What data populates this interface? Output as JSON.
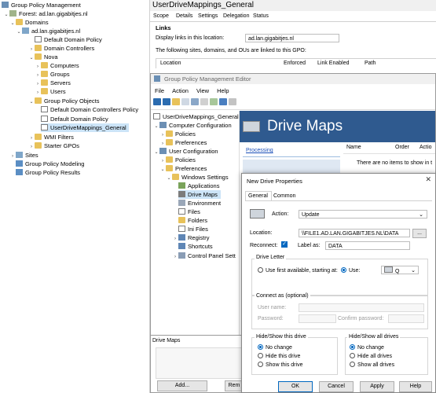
{
  "gpm_tree": [
    {
      "label": "Group Policy Management",
      "icon": "gpm-icon"
    },
    {
      "label": "Forest: ad.lan.gigabitjes.nl",
      "icon": "forest-icon"
    },
    {
      "label": "Domains",
      "icon": "folder-icon"
    },
    {
      "label": "ad.lan.gigabitjes.nl",
      "icon": "domain-icon"
    },
    {
      "label": "Default Domain Policy",
      "icon": "gpo-link-icon"
    },
    {
      "label": "Domain Controllers",
      "icon": "ou-icon"
    },
    {
      "label": "Nova",
      "icon": "ou-icon"
    },
    {
      "label": "Computers",
      "icon": "ou-icon"
    },
    {
      "label": "Groups",
      "icon": "ou-icon"
    },
    {
      "label": "Servers",
      "icon": "ou-icon"
    },
    {
      "label": "Users",
      "icon": "ou-icon"
    },
    {
      "label": "Group Policy Objects",
      "icon": "folder-icon"
    },
    {
      "label": "Default Domain Controllers Policy",
      "icon": "gpo-icon"
    },
    {
      "label": "Default Domain Policy",
      "icon": "gpo-icon"
    },
    {
      "label": "UserDriveMappings_General",
      "icon": "gpo-icon"
    },
    {
      "label": "WMI Filters",
      "icon": "folder-icon"
    },
    {
      "label": "Starter GPOs",
      "icon": "folder-icon"
    },
    {
      "label": "Sites",
      "icon": "sites-icon"
    },
    {
      "label": "Group Policy Modeling",
      "icon": "modeling-icon"
    },
    {
      "label": "Group Policy Results",
      "icon": "results-icon"
    }
  ],
  "gpm_right": {
    "title": "UserDriveMappings_General",
    "tabs": [
      "Scope",
      "Details",
      "Settings",
      "Delegation",
      "Status"
    ],
    "links_heading": "Links",
    "display_links_label": "Display links in this location:",
    "display_links_value": "ad.lan.gigabitjes.nl",
    "linked_text": "The following sites, domains, and OUs are linked to this GPO:",
    "columns": [
      "Location",
      "Enforced",
      "Link Enabled",
      "Path"
    ]
  },
  "editor": {
    "title": "Group Policy Management Editor",
    "menu": [
      "File",
      "Action",
      "View",
      "Help"
    ],
    "tree": [
      {
        "label": "UserDriveMappings_General"
      },
      {
        "label": "Computer Configuration"
      },
      {
        "label": "Policies"
      },
      {
        "label": "Preferences"
      },
      {
        "label": "User Configuration"
      },
      {
        "label": "Policies"
      },
      {
        "label": "Preferences"
      },
      {
        "label": "Windows Settings"
      },
      {
        "label": "Applications"
      },
      {
        "label": "Drive Maps"
      },
      {
        "label": "Environment"
      },
      {
        "label": "Files"
      },
      {
        "label": "Folders"
      },
      {
        "label": "Ini Files"
      },
      {
        "label": "Registry"
      },
      {
        "label": "Shortcuts"
      },
      {
        "label": "Control Panel Sett"
      }
    ],
    "banner_title": "Drive Maps",
    "processing_link": "Processing",
    "list_columns": [
      "Name",
      "Order",
      "Actio"
    ],
    "empty_text": "There are no items to show in t",
    "bottom_tab": "Drive Maps",
    "add_button": "Add...",
    "remove_button": "Rem"
  },
  "dialog": {
    "title": "New Drive Properties",
    "tabs": [
      "General",
      "Common"
    ],
    "action_label": "Action:",
    "action_value": "Update",
    "location_label": "Location:",
    "location_value": "\\\\FILE1.AD.LAN.GIGABITJES.NL\\DATA",
    "browse_button": "...",
    "reconnect_label": "Reconnect:",
    "label_as_label": "Label as:",
    "label_as_value": "DATA",
    "drive_letter_heading": "Drive Letter",
    "use_first_label": "Use first available, starting at:",
    "use_label": "Use:",
    "drive_value": "Q",
    "connect_as_heading": "Connect as (optional)",
    "user_name_label": "User name:",
    "password_label": "Password:",
    "confirm_password_label": "Confirm password:",
    "hide_show_drive_heading": "Hide/Show this drive",
    "hide_show_drive_options": [
      "No change",
      "Hide this drive",
      "Show this drive"
    ],
    "hide_show_all_heading": "Hide/Show all drives",
    "hide_show_all_options": [
      "No change",
      "Hide all drives",
      "Show all drives"
    ],
    "ok_button": "OK",
    "cancel_button": "Cancel",
    "apply_button": "Apply",
    "help_button": "Help"
  }
}
